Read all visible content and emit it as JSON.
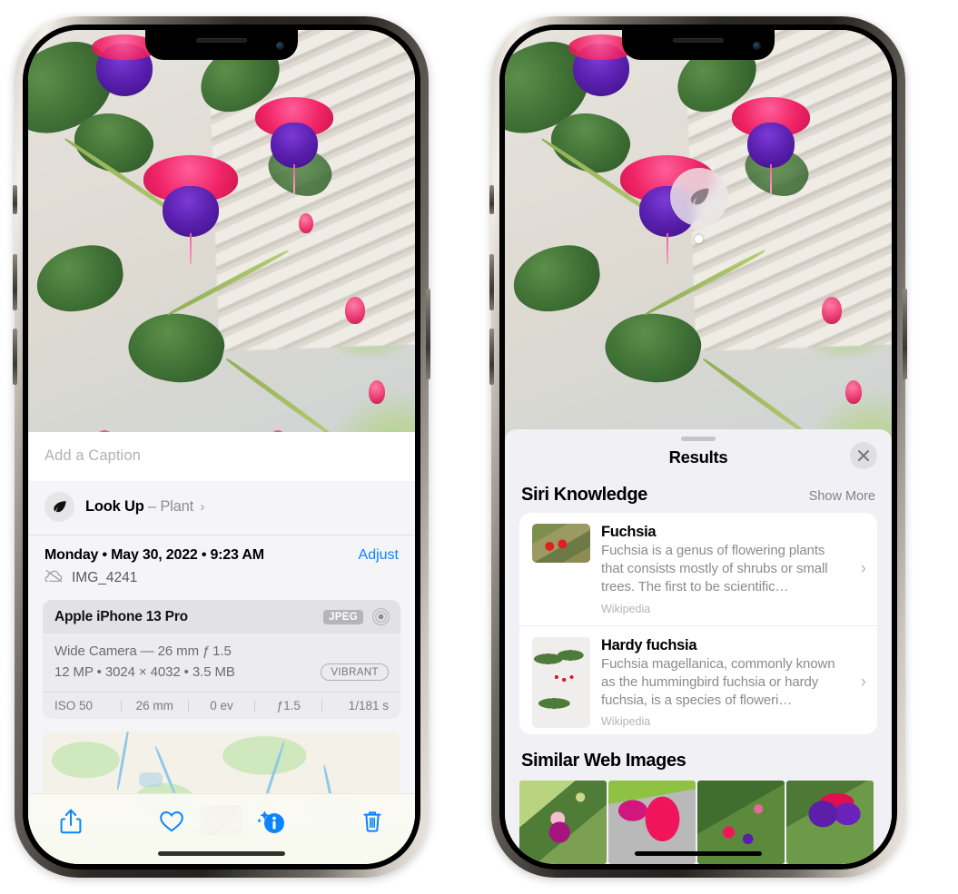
{
  "left_phone": {
    "name": "Photos app — photo info view",
    "photo": {
      "alt": "Fuchsia flowers hanging basket on a porch"
    },
    "caption_field": {
      "placeholder": "Add a Caption",
      "value": ""
    },
    "look_up": {
      "icon": "leaf-icon",
      "label": "Look Up",
      "dash": "–",
      "subject": "Plant",
      "chevron": "›"
    },
    "meta": {
      "datetime": "Monday • May 30, 2022 • 9:23 AM",
      "adjust_label": "Adjust",
      "filename": "IMG_4241",
      "cloud_icon": "icloud-slash-icon"
    },
    "exif": {
      "device": "Apple iPhone 13 Pro",
      "format_badge": "JPEG",
      "lens_icon": "lens-icon",
      "lens_line": "Wide Camera — 26 mm ƒ 1.5",
      "size_line": "12 MP • 3024 × 4032 • 3.5 MB",
      "style_badge": "VIBRANT",
      "stats": [
        "ISO 50",
        "26 mm",
        "0 ev",
        "ƒ1.5",
        "1/181 s"
      ]
    },
    "map": {
      "pin_label": "photo-location-pin"
    },
    "toolbar": [
      {
        "name": "share-button",
        "icon": "share-icon"
      },
      {
        "name": "favorite-button",
        "icon": "heart-icon"
      },
      {
        "name": "info-button",
        "icon": "info-sparkle-icon"
      },
      {
        "name": "delete-button",
        "icon": "trash-icon"
      }
    ],
    "accent_color": "#0b84ff"
  },
  "right_phone": {
    "name": "Visual Look Up results sheet",
    "vision_badge": {
      "icon": "leaf-icon"
    },
    "sheet": {
      "grabber": "sheet-grabber",
      "title": "Results",
      "close_label": "✕"
    },
    "siri_knowledge": {
      "title": "Siri Knowledge",
      "show_more": "Show More",
      "entries": [
        {
          "title": "Fuchsia",
          "description": "Fuchsia is a genus of flowering plants that consists mostly of shrubs or small trees. The first to be scientific…",
          "source": "Wikipedia",
          "chevron": "›",
          "thumb": "fuchsia-red-flowers-thumbnail"
        },
        {
          "title": "Hardy fuchsia",
          "description": "Fuchsia magellanica, commonly known as the hummingbird fuchsia or hardy fuchsia, is a species of floweri…",
          "source": "Wikipedia",
          "chevron": "›",
          "thumb": "hardy-fuchsia-specimen-thumbnail"
        }
      ]
    },
    "similar_web_images": {
      "title": "Similar Web Images",
      "thumbs": [
        "fuchsia-pink-purple-bloom",
        "fuchsia-red-closeup",
        "fuchsia-bush-buds",
        "fuchsia-purple-red-cluster"
      ]
    }
  }
}
